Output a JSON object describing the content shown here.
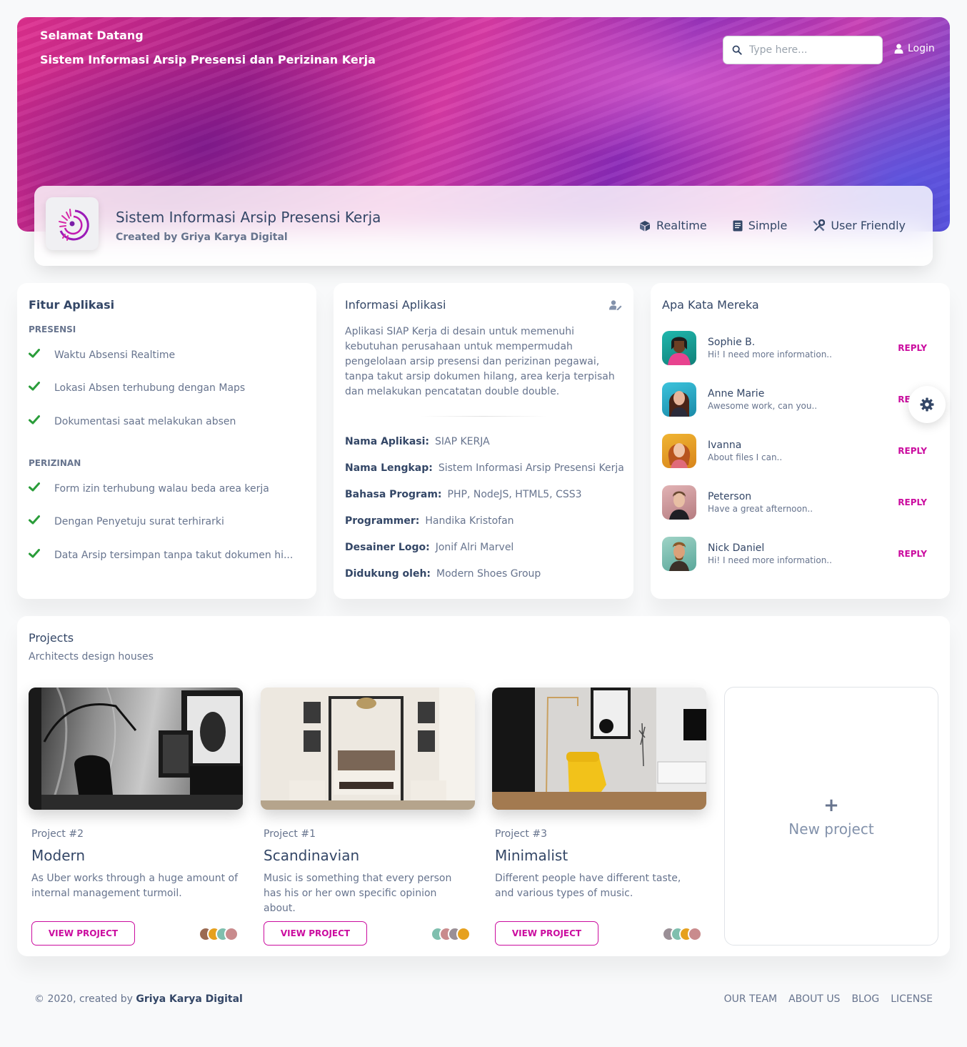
{
  "header": {
    "welcome": "Selamat Datang",
    "subtitle": "Sistem Informasi Arsip Presensi dan Perizinan Kerja",
    "search_placeholder": "Type here...",
    "login_label": "Login"
  },
  "profile": {
    "title": "Sistem Informasi Arsip Presensi Kerja",
    "created_by": "Created by Griya Karya Digital",
    "tabs": [
      {
        "label": "Realtime",
        "icon": "cube-icon"
      },
      {
        "label": "Simple",
        "icon": "document-icon"
      },
      {
        "label": "User Friendly",
        "icon": "tools-icon"
      }
    ]
  },
  "features": {
    "title": "Fitur Aplikasi",
    "section1": "PRESENSI",
    "items1": [
      "Waktu Absensi Realtime",
      "Lokasi Absen terhubung dengan Maps",
      "Dokumentasi saat melakukan absen"
    ],
    "section2": "PERIZINAN",
    "items2": [
      "Form izin terhubung walau beda area kerja",
      "Dengan Penyetuju surat terhirarki",
      "Data Arsip tersimpan tanpa takut dokumen hi..."
    ]
  },
  "info": {
    "title": "Informasi Aplikasi",
    "description": "Aplikasi SIAP Kerja di desain untuk memenuhi kebutuhan perusahaan untuk mempermudah pengelolaan arsip presensi dan perizinan pegawai, tanpa takut arsip dokumen hilang, area kerja terpisah dan melakukan pencatatan double double.",
    "rows": [
      {
        "label": "Nama Aplikasi:",
        "value": "SIAP KERJA"
      },
      {
        "label": "Nama Lengkap:",
        "value": "Sistem Informasi Arsip Presensi Kerja"
      },
      {
        "label": "Bahasa Program:",
        "value": "PHP, NodeJS, HTML5, CSS3"
      },
      {
        "label": "Programmer:",
        "value": "Handika Kristofan"
      },
      {
        "label": "Desainer Logo:",
        "value": "Jonif Alri Marvel"
      },
      {
        "label": "Didukung oleh:",
        "value": "Modern Shoes Group"
      }
    ]
  },
  "testimonials": {
    "title": "Apa Kata Mereka",
    "reply_label": "REPLY",
    "items": [
      {
        "name": "Sophie B.",
        "message": "Hi! I need more information..",
        "color": "#19a7a0"
      },
      {
        "name": "Anne Marie",
        "message": "Awesome work, can you..",
        "color": "#2fb3c9"
      },
      {
        "name": "Ivanna",
        "message": "About files I can..",
        "color": "#e6a11f"
      },
      {
        "name": "Peterson",
        "message": "Have a great afternoon..",
        "color": "#c98b8d"
      },
      {
        "name": "Nick Daniel",
        "message": "Hi! I need more information..",
        "color": "#7fbfae"
      }
    ]
  },
  "projects": {
    "title": "Projects",
    "subtitle": "Architects design houses",
    "button_label": "VIEW PROJECT",
    "new_project_label": "New project",
    "items": [
      {
        "number": "Project #2",
        "name": "Modern",
        "description": "As Uber works through a huge amount of internal management turmoil."
      },
      {
        "number": "Project #1",
        "name": "Scandinavian",
        "description": "Music is something that every person has his or her own specific opinion about."
      },
      {
        "number": "Project #3",
        "name": "Minimalist",
        "description": "Different people have different taste, and various types of music."
      }
    ]
  },
  "footer": {
    "copyright": "© 2020, created by",
    "brand": "Griya Karya Digital",
    "links": [
      "OUR TEAM",
      "ABOUT US",
      "BLOG",
      "LICENSE"
    ]
  },
  "colors": {
    "accent": "#cb0c9f",
    "text_dark": "#344767",
    "text_muted": "#67748e",
    "check": "#2dce89"
  }
}
